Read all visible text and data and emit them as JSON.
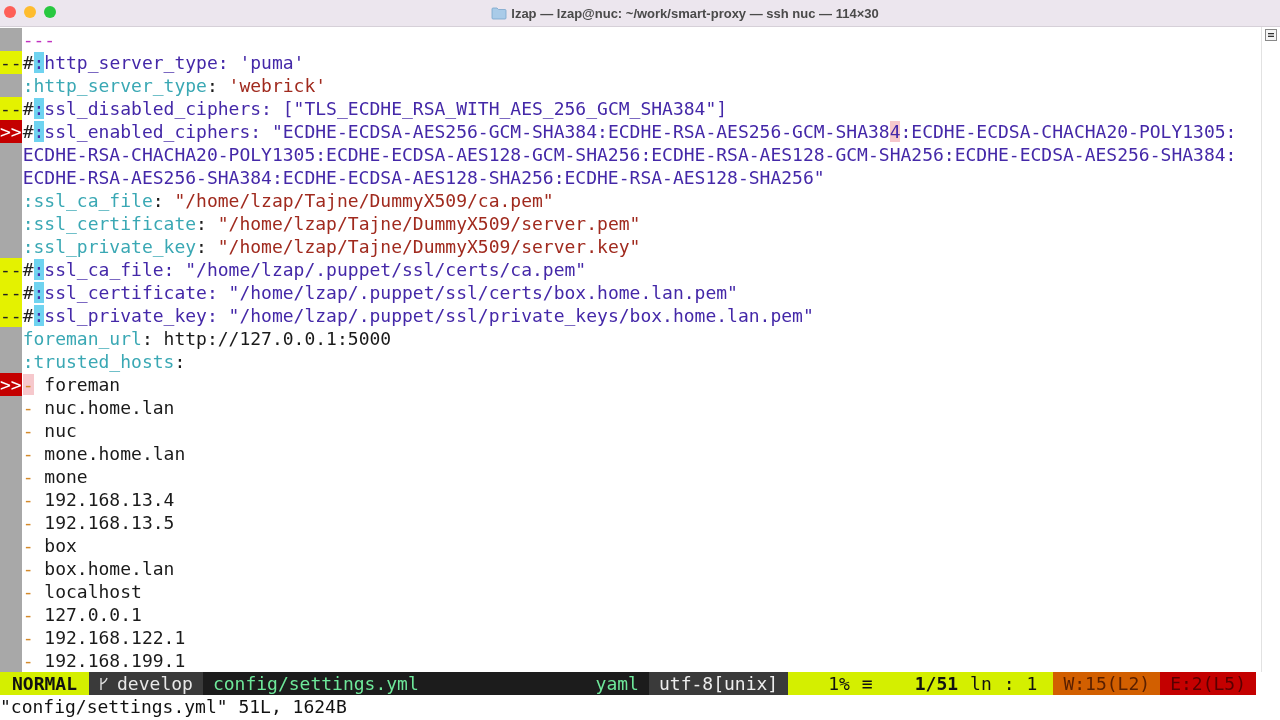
{
  "window": {
    "title": "lzap — lzap@nuc: ~/work/smart-proxy — ssh nuc — 114×30"
  },
  "lines": [
    {
      "segments": [
        {
          "kind": "doc",
          "text": "---"
        }
      ]
    },
    {
      "sign": {
        "kind": "warning",
        "text": "--"
      },
      "segments": [
        {
          "kind": "hash",
          "text": "#"
        },
        {
          "kind": "colon",
          "text": ":"
        },
        {
          "kind": "comment",
          "text": "http_server_type: 'puma'"
        }
      ]
    },
    {
      "segments": [
        {
          "kind": "key",
          "text": ":http_server_type"
        },
        {
          "kind": "plain",
          "text": ": "
        },
        {
          "kind": "string",
          "text": "'webrick'"
        }
      ]
    },
    {
      "sign": {
        "kind": "warning",
        "text": "--"
      },
      "segments": [
        {
          "kind": "hash",
          "text": "#"
        },
        {
          "kind": "colon",
          "text": ":"
        },
        {
          "kind": "comment",
          "text": "ssl_disabled_ciphers: [\"TLS_ECDHE_RSA_WITH_AES_256_GCM_SHA384\"]"
        }
      ]
    },
    {
      "sign": {
        "kind": "error",
        "text": ">>"
      },
      "segments": [
        {
          "kind": "hash",
          "text": "#"
        },
        {
          "kind": "colon",
          "text": ":"
        },
        {
          "kind": "comment",
          "text": "ssl_enabled_ciphers: \"ECDHE-ECDSA-AES256-GCM-SHA384:ECDHE-RSA-AES256-GCM-SHA38"
        },
        {
          "kind": "match",
          "text": "4"
        },
        {
          "kind": "comment",
          "text": ":ECDHE-ECDSA-CHACHA20-POLY1305:ECDHE-RSA-CHACHA20-POLY1305:ECDHE-ECDSA-AES128-GCM-SHA256:ECDHE-RSA-AES128-GCM-SHA256:ECDHE-ECDSA-AES256-SHA384:ECDHE-RSA-AES256-SHA384:ECDHE-ECDSA-AES128-SHA256:ECDHE-RSA-AES128-SHA256\""
        }
      ]
    },
    {
      "segments": [
        {
          "kind": "key",
          "text": ":ssl_ca_file"
        },
        {
          "kind": "plain",
          "text": ": "
        },
        {
          "kind": "string",
          "text": "\"/home/lzap/Tajne/DummyX509/ca.pem\""
        }
      ]
    },
    {
      "segments": [
        {
          "kind": "key",
          "text": ":ssl_certificate"
        },
        {
          "kind": "plain",
          "text": ": "
        },
        {
          "kind": "string",
          "text": "\"/home/lzap/Tajne/DummyX509/server.pem\""
        }
      ]
    },
    {
      "segments": [
        {
          "kind": "key",
          "text": ":ssl_private_key"
        },
        {
          "kind": "plain",
          "text": ": "
        },
        {
          "kind": "string",
          "text": "\"/home/lzap/Tajne/DummyX509/server.key\""
        }
      ]
    },
    {
      "sign": {
        "kind": "warning",
        "text": "--"
      },
      "segments": [
        {
          "kind": "hash",
          "text": "#"
        },
        {
          "kind": "colon",
          "text": ":"
        },
        {
          "kind": "comment",
          "text": "ssl_ca_file: \"/home/lzap/.puppet/ssl/certs/ca.pem\""
        }
      ]
    },
    {
      "sign": {
        "kind": "warning",
        "text": "--"
      },
      "segments": [
        {
          "kind": "hash",
          "text": "#"
        },
        {
          "kind": "colon",
          "text": ":"
        },
        {
          "kind": "comment",
          "text": "ssl_certificate: \"/home/lzap/.puppet/ssl/certs/box.home.lan.pem\""
        }
      ]
    },
    {
      "sign": {
        "kind": "warning",
        "text": "--"
      },
      "segments": [
        {
          "kind": "hash",
          "text": "#"
        },
        {
          "kind": "colon",
          "text": ":"
        },
        {
          "kind": "comment",
          "text": "ssl_private_key: \"/home/lzap/.puppet/ssl/private_keys/box.home.lan.pem\""
        }
      ]
    },
    {
      "segments": [
        {
          "kind": "key",
          "text": "foreman_url"
        },
        {
          "kind": "plain",
          "text": ": http://127.0.0.1:5000"
        }
      ]
    },
    {
      "segments": [
        {
          "kind": "key",
          "text": ":trusted_hosts"
        },
        {
          "kind": "plain",
          "text": ":"
        }
      ]
    },
    {
      "sign": {
        "kind": "error",
        "text": ">>"
      },
      "segments": [
        {
          "kind": "errdash",
          "text": "-"
        },
        {
          "kind": "plain",
          "text": " foreman"
        }
      ]
    },
    {
      "segments": [
        {
          "kind": "dash",
          "text": "-"
        },
        {
          "kind": "plain",
          "text": " nuc.home.lan"
        }
      ]
    },
    {
      "segments": [
        {
          "kind": "dash",
          "text": "-"
        },
        {
          "kind": "plain",
          "text": " nuc"
        }
      ]
    },
    {
      "segments": [
        {
          "kind": "dash",
          "text": "-"
        },
        {
          "kind": "plain",
          "text": " mone.home.lan"
        }
      ]
    },
    {
      "segments": [
        {
          "kind": "dash",
          "text": "-"
        },
        {
          "kind": "plain",
          "text": " mone"
        }
      ]
    },
    {
      "segments": [
        {
          "kind": "dash",
          "text": "-"
        },
        {
          "kind": "plain",
          "text": " 192.168.13.4"
        }
      ]
    },
    {
      "segments": [
        {
          "kind": "dash",
          "text": "-"
        },
        {
          "kind": "plain",
          "text": " 192.168.13.5"
        }
      ]
    },
    {
      "segments": [
        {
          "kind": "dash",
          "text": "-"
        },
        {
          "kind": "plain",
          "text": " box"
        }
      ]
    },
    {
      "segments": [
        {
          "kind": "dash",
          "text": "-"
        },
        {
          "kind": "plain",
          "text": " box.home.lan"
        }
      ]
    },
    {
      "segments": [
        {
          "kind": "dash",
          "text": "-"
        },
        {
          "kind": "plain",
          "text": " localhost"
        }
      ]
    },
    {
      "segments": [
        {
          "kind": "dash",
          "text": "-"
        },
        {
          "kind": "plain",
          "text": " 127.0.0.1"
        }
      ]
    },
    {
      "segments": [
        {
          "kind": "dash",
          "text": "-"
        },
        {
          "kind": "plain",
          "text": " 192.168.122.1"
        }
      ]
    },
    {
      "segments": [
        {
          "kind": "dash",
          "text": "-"
        },
        {
          "kind": "plain",
          "text": " 192.168.199.1"
        }
      ]
    }
  ],
  "statusline": {
    "mode": "NORMAL",
    "branch": "develop",
    "file": "config/settings.yml",
    "filetype": "yaml",
    "encoding": "utf-8[unix]",
    "percent": "1%",
    "percent_icon": "≡",
    "position": "1/51",
    "ln_label": "ln",
    "separator": ":",
    "column": "1",
    "warnings": "W:15(L2)",
    "errors": "E:2(L5)"
  },
  "message": "\"config/settings.yml\" 51L, 1624B"
}
